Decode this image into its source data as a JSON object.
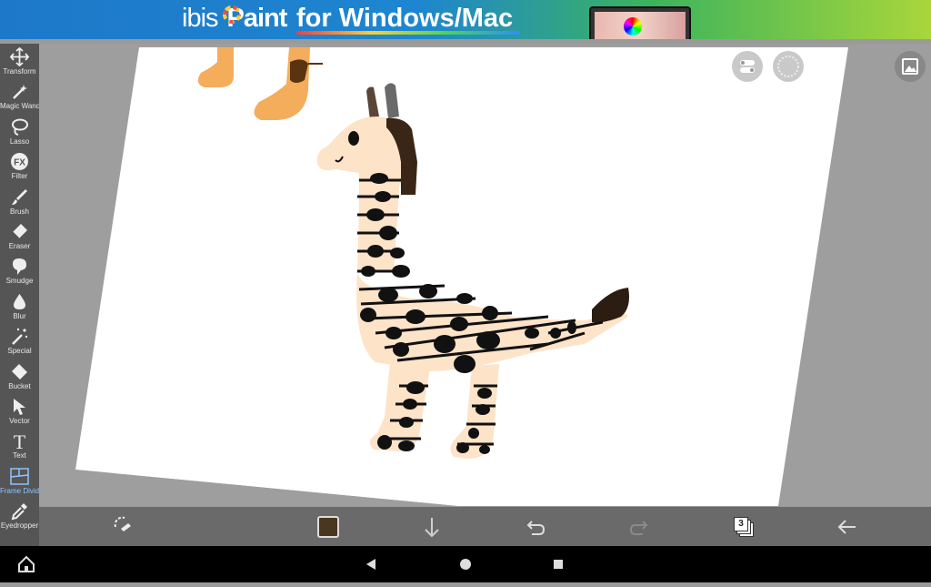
{
  "banner": {
    "brand_prefix": "ibis",
    "brand_suffix": "Paint",
    "tagline": "for Windows/Mac"
  },
  "toolbar": {
    "tools": [
      {
        "label": "Transform",
        "icon": "move-arrows-icon"
      },
      {
        "label": "Magic Wand",
        "icon": "magic-wand-icon"
      },
      {
        "label": "Lasso",
        "icon": "lasso-icon"
      },
      {
        "label": "Filter",
        "icon": "fx-icon"
      },
      {
        "label": "Brush",
        "icon": "brush-icon"
      },
      {
        "label": "Eraser",
        "icon": "eraser-icon"
      },
      {
        "label": "Smudge",
        "icon": "smudge-icon"
      },
      {
        "label": "Blur",
        "icon": "drop-icon"
      },
      {
        "label": "Special",
        "icon": "sparkle-wand-icon"
      },
      {
        "label": "Bucket",
        "icon": "bucket-icon"
      },
      {
        "label": "Vector",
        "icon": "cursor-arrow-icon"
      },
      {
        "label": "Text",
        "icon": "text-t-icon"
      },
      {
        "label": "Frame Divider",
        "icon": "frame-divider-icon",
        "active": true
      },
      {
        "label": "Eyedropper",
        "icon": "eyedropper-icon"
      }
    ]
  },
  "bottombar": {
    "layer_count": "3",
    "current_color": "#4a3720"
  },
  "colors": {
    "toolbar_bg": "#555555",
    "bottombar_bg": "#6a6a6a",
    "active_tool_label": "#8fc4ff",
    "giraffe_body": "#fde3c8",
    "giraffe_spots": "#111111",
    "mane": "#3a2616",
    "orange_legs": "#f4ad5a"
  }
}
